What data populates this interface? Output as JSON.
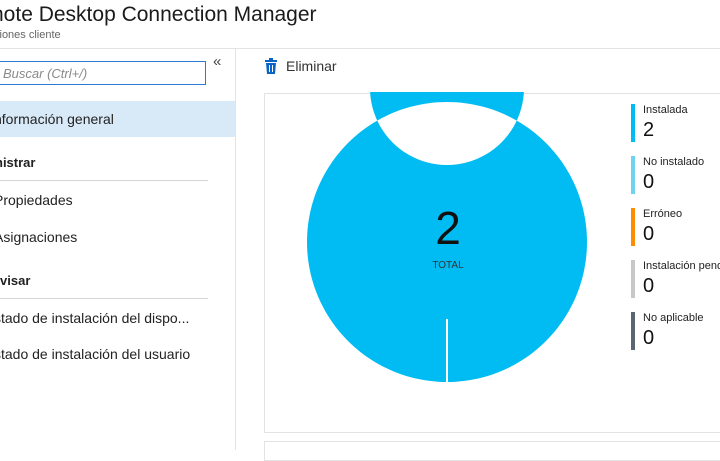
{
  "header": {
    "title": "note Desktop Connection Manager",
    "subtitle": "ciones cliente"
  },
  "sidebar": {
    "search_placeholder": "Buscar (Ctrl+/)",
    "collapse_glyph": "«",
    "items": [
      {
        "label": "nformación general",
        "active": true
      },
      {
        "label": "Propiedades"
      },
      {
        "label": "Asignaciones"
      },
      {
        "label": "stado de instalación del dispo..."
      },
      {
        "label": "stado de instalación del usuario"
      }
    ],
    "sections": [
      "nistrar",
      "rvisar"
    ]
  },
  "toolbar": {
    "delete_label": "Eliminar",
    "delete_icon": "trash-icon"
  },
  "chart_data": {
    "type": "pie",
    "variant": "donut",
    "center_value": "2",
    "center_label": "TOTAL",
    "categories": [
      "Instalada",
      "No instalado",
      "Erróneo",
      "Instalación pendi",
      "No aplicable"
    ],
    "values": [
      2,
      0,
      0,
      0,
      0
    ],
    "colors": [
      "#00bcf2",
      "#6fd3ef",
      "#ff8c00",
      "#c8c8c8",
      "#5a6673"
    ]
  }
}
